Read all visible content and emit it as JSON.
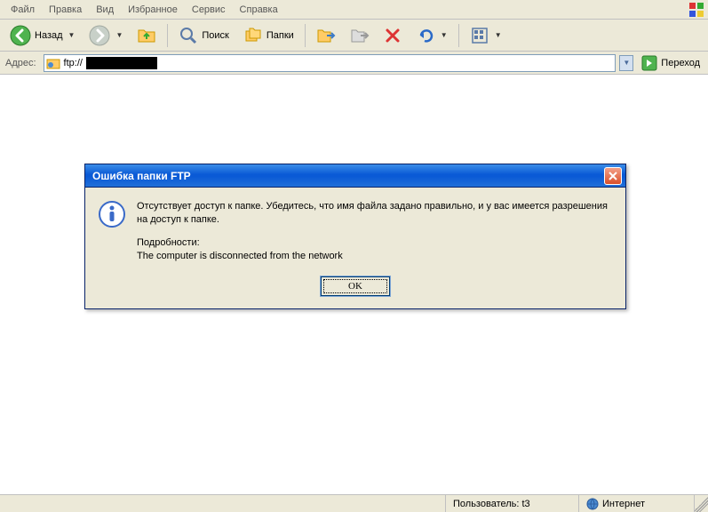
{
  "menu": {
    "file": "Файл",
    "edit": "Правка",
    "view": "Вид",
    "favorites": "Избранное",
    "tools": "Сервис",
    "help": "Справка"
  },
  "toolbar": {
    "back": "Назад",
    "search": "Поиск",
    "folders": "Папки"
  },
  "address": {
    "label": "Адрес:",
    "value": "ftp://",
    "go": "Переход"
  },
  "dialog": {
    "title": "Ошибка папки FTP",
    "message": "Отсутствует доступ к папке. Убедитесь, что имя файла задано правильно, и у вас имеется разрешения на доступ к папке.",
    "details_label": "Подробности:",
    "details_text": "The computer is disconnected from the network",
    "ok": "OK"
  },
  "status": {
    "user": "Пользователь: t3",
    "zone": "Интернет"
  }
}
